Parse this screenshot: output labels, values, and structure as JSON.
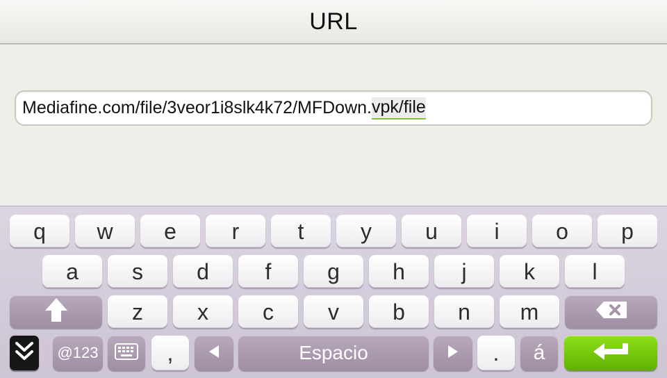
{
  "header": {
    "title": "URL"
  },
  "url_input": {
    "value_prefix": "Mediafine.com/file/3veor1i8slk4k72/MFDown.",
    "value_composing": "vpk/file"
  },
  "keyboard": {
    "row1": [
      "q",
      "w",
      "e",
      "r",
      "t",
      "y",
      "u",
      "i",
      "o",
      "p"
    ],
    "row2": [
      "a",
      "s",
      "d",
      "f",
      "g",
      "h",
      "j",
      "k",
      "l"
    ],
    "row3": [
      "z",
      "x",
      "c",
      "v",
      "b",
      "n",
      "m"
    ],
    "symbols_label": "@123",
    "comma_label": ",",
    "space_label": "Espacio",
    "period_label": ".",
    "accent_label": "á",
    "icons": {
      "hide": "double-chevron-down-icon",
      "keyboard": "keyboard-icon",
      "left": "triangle-left-icon",
      "right": "triangle-right-icon",
      "shift": "shift-arrow-icon",
      "backspace": "backspace-icon",
      "enter": "enter-icon"
    },
    "colors": {
      "enter_key": "#6cc30a",
      "function_key": "#a897ad",
      "letter_key": "#ffffff"
    }
  }
}
